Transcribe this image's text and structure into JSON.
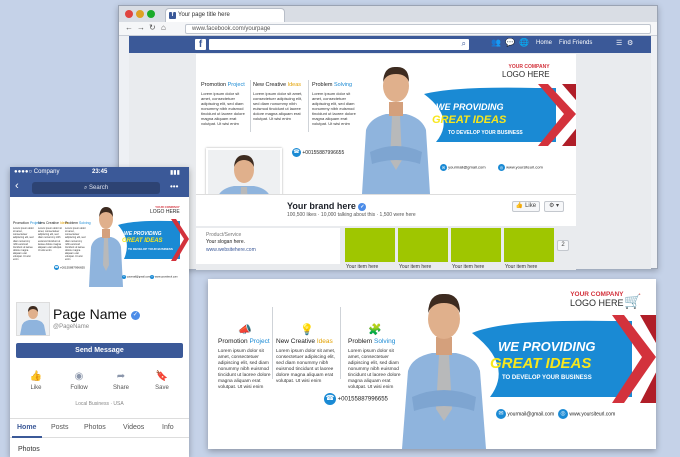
{
  "browser": {
    "tab_title": "Your page title here",
    "address": "www.facebook.com/yourpage",
    "fb_logo": "f",
    "nav_home": "Home",
    "nav_find_friends": "Find Friends"
  },
  "cover": {
    "col1_head_a": "Promotion",
    "col1_head_b": "Project",
    "col2_head_a": "New Creative",
    "col2_head_b": "Ideas",
    "col3_head_a": "Problem",
    "col3_head_b": "Solving",
    "lorem": "Lorem ipsum dolor sit amet, consectetuer adipiscing elit, sed diam nonummy nibh euismod tincidunt ut laoree dolore magna aliquam erat volutpat. Ut wisi enim",
    "logo_line1": "YOUR COMPANY",
    "logo_line2": "LOGO HERE",
    "headline1": "WE PROVIDING",
    "headline2": "GREAT IDEAS",
    "headline3": "TO DEVELOP YOUR BUSINESS",
    "phone": "+00155887996655",
    "email": "yourmail@gmail.com",
    "web": "www.yoursiteurl.com",
    "colors": {
      "blue": "#1a8ad4",
      "yellow": "#f8e71c",
      "red": "#d3323c",
      "green": "#9fc600"
    }
  },
  "desktop_page": {
    "brand": "Your brand here",
    "stats": "100,500 likes · 10,000 talking about this · 1,500 were here",
    "like_label": "Like",
    "more_label": "▾",
    "category": "Product/Service",
    "slogan": "Your slogan here.",
    "website": "www.websitehere.com",
    "items": [
      "Your item here",
      "Your item here",
      "Your item here",
      "Your item here"
    ],
    "more_count": "2"
  },
  "phone": {
    "carrier": "●●●●○ Company",
    "time": "23:45",
    "battery": "▮▮▮",
    "search": "Search",
    "page_name": "Page Name",
    "username": "@PageName",
    "send_message": "Send Message",
    "actions": [
      "Like",
      "Follow",
      "Share",
      "Save"
    ],
    "category": "Local Business · USA",
    "tabs": [
      "Home",
      "Posts",
      "Photos",
      "Videos",
      "Info"
    ],
    "photos_label": "Photos"
  }
}
